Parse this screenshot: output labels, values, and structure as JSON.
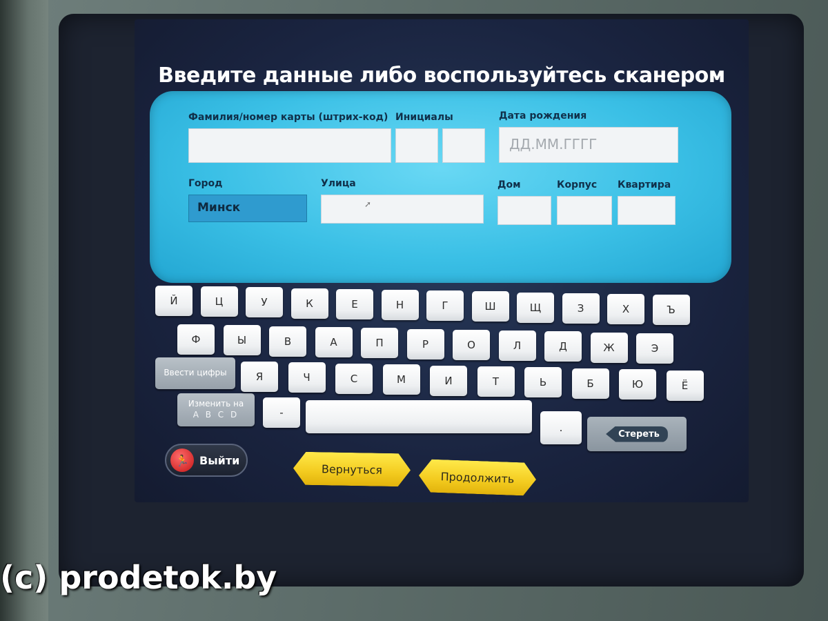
{
  "title": "Введите данные либо воспользуйтесь сканером",
  "form": {
    "surname_label": "Фамилия/номер карты (штрих-код)",
    "initials_label": "Инициалы",
    "dob_label": "Дата рождения",
    "dob_placeholder": "ДД.ММ.ГГГГ",
    "city_label": "Город",
    "city_value": "Минск",
    "street_label": "Улица",
    "house_label": "Дом",
    "building_label": "Корпус",
    "apartment_label": "Квартира"
  },
  "keyboard": {
    "row1": [
      "Й",
      "Ц",
      "У",
      "К",
      "Е",
      "Н",
      "Г",
      "Ш",
      "Щ",
      "З",
      "Х",
      "Ъ"
    ],
    "row2": [
      "Ф",
      "Ы",
      "В",
      "А",
      "П",
      "Р",
      "О",
      "Л",
      "Д",
      "Ж",
      "Э"
    ],
    "row3": [
      "Я",
      "Ч",
      "С",
      "М",
      "И",
      "Т",
      "Ь",
      "Б",
      "Ю",
      "Ё"
    ],
    "digits_label": "Ввести цифры",
    "layout_label": "Изменить на",
    "layout_alt": "A B C D",
    "dash": "-",
    "dot": ".",
    "backspace_label": "Стереть"
  },
  "buttons": {
    "exit_label": "Выйти",
    "back_label": "Вернуться",
    "continue_label": "Продолжить"
  },
  "watermark": "(c) prodetok.by"
}
